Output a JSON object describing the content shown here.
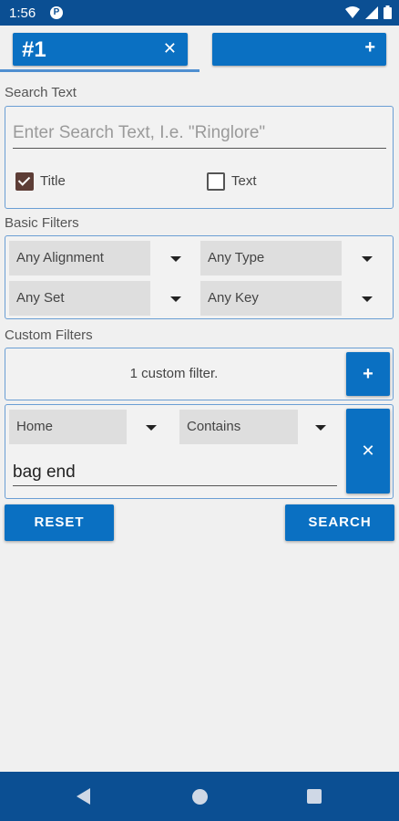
{
  "status": {
    "time": "1:56",
    "app_badge": "P"
  },
  "tabs": [
    {
      "label": "#1",
      "close": "✕"
    },
    {
      "add": "+"
    }
  ],
  "search_text": {
    "section_label": "Search Text",
    "placeholder": "Enter Search Text, I.e. \"Ringlore\"",
    "title_label": "Title",
    "title_checked": true,
    "text_label": "Text",
    "text_checked": false
  },
  "basic_filters": {
    "section_label": "Basic Filters",
    "alignment": "Any Alignment",
    "type": "Any Type",
    "set": "Any Set",
    "key": "Any Key"
  },
  "custom_filters": {
    "section_label": "Custom Filters",
    "summary": "1 custom filter.",
    "add": "+",
    "filter": {
      "field": "Home",
      "operator": "Contains",
      "value": "bag end",
      "remove": "✕"
    }
  },
  "actions": {
    "reset": "RESET",
    "search": "SEARCH"
  },
  "colors": {
    "primary": "#0a70c2",
    "appbar": "#0b4f93",
    "panel_border": "#6a9ed4"
  }
}
